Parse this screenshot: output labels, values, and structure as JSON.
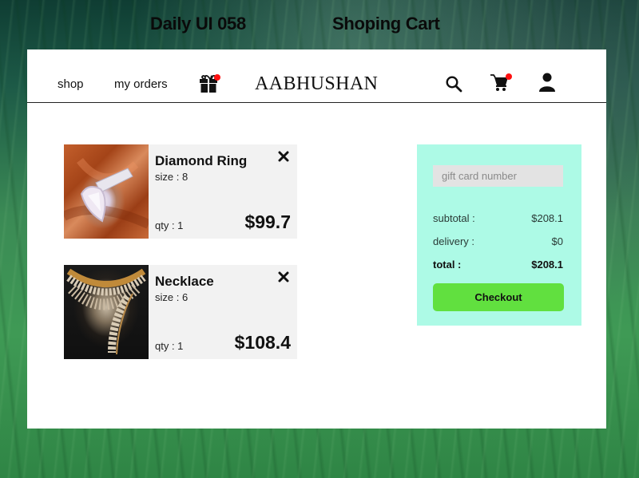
{
  "page_titles": {
    "left": "Daily UI 058",
    "right": "Shoping Cart"
  },
  "nav": {
    "links": [
      {
        "label": "shop"
      },
      {
        "label": "my orders"
      }
    ],
    "brand": "AABHUSHAN",
    "icons": {
      "gift": "gift-icon",
      "search": "search-icon",
      "cart": "cart-icon",
      "user": "user-icon"
    },
    "badge_color": "#ff1010"
  },
  "cart": {
    "items": [
      {
        "name": "Diamond Ring",
        "size": "size : 8",
        "qty": "qty : 1",
        "price": "$99.7",
        "image": "diamond ring on orange satin"
      },
      {
        "name": "Necklace",
        "size": "size : 6",
        "qty": "qty : 1",
        "price": "$108.4",
        "image": "diamond necklace on black bust"
      }
    ],
    "remove_icon": "close-icon"
  },
  "summary": {
    "gift_card_placeholder": "gift card number",
    "gift_card_value": "",
    "subtotal_label": "subtotal :",
    "subtotal_value": "$208.1",
    "delivery_label": "delivery :",
    "delivery_value": "$0",
    "total_label": "total :",
    "total_value": "$208.1",
    "checkout_label": "Checkout",
    "panel_color": "#adfae6",
    "checkout_color": "#61e03f"
  }
}
